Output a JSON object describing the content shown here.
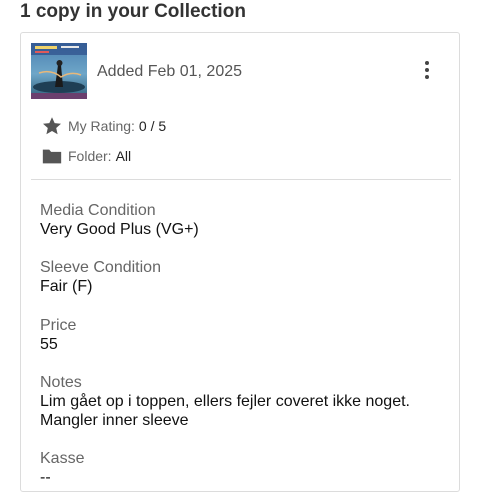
{
  "header": {
    "title": "1 copy in your Collection"
  },
  "item": {
    "added": "Added Feb 01, 2025",
    "rating_label": "My Rating:",
    "rating_value": "0 / 5",
    "folder_label": "Folder:",
    "folder_value": "All"
  },
  "fields": [
    {
      "label": "Media Condition",
      "value": "Very Good Plus (VG+)"
    },
    {
      "label": "Sleeve Condition",
      "value": "Fair (F)"
    },
    {
      "label": "Price",
      "value": "55"
    },
    {
      "label": "Notes",
      "value_line1": "Lim gået op i toppen, ellers fejler coveret ikke noget.",
      "value_line2": "Mangler inner sleeve"
    },
    {
      "label": "Kasse",
      "value": "--"
    }
  ],
  "icons": {
    "rating": "star-icon",
    "folder": "folder-icon",
    "menu": "more-vertical-icon"
  },
  "colors": {
    "icon": "#555555",
    "border": "#dcdcdc",
    "label": "#666666"
  }
}
